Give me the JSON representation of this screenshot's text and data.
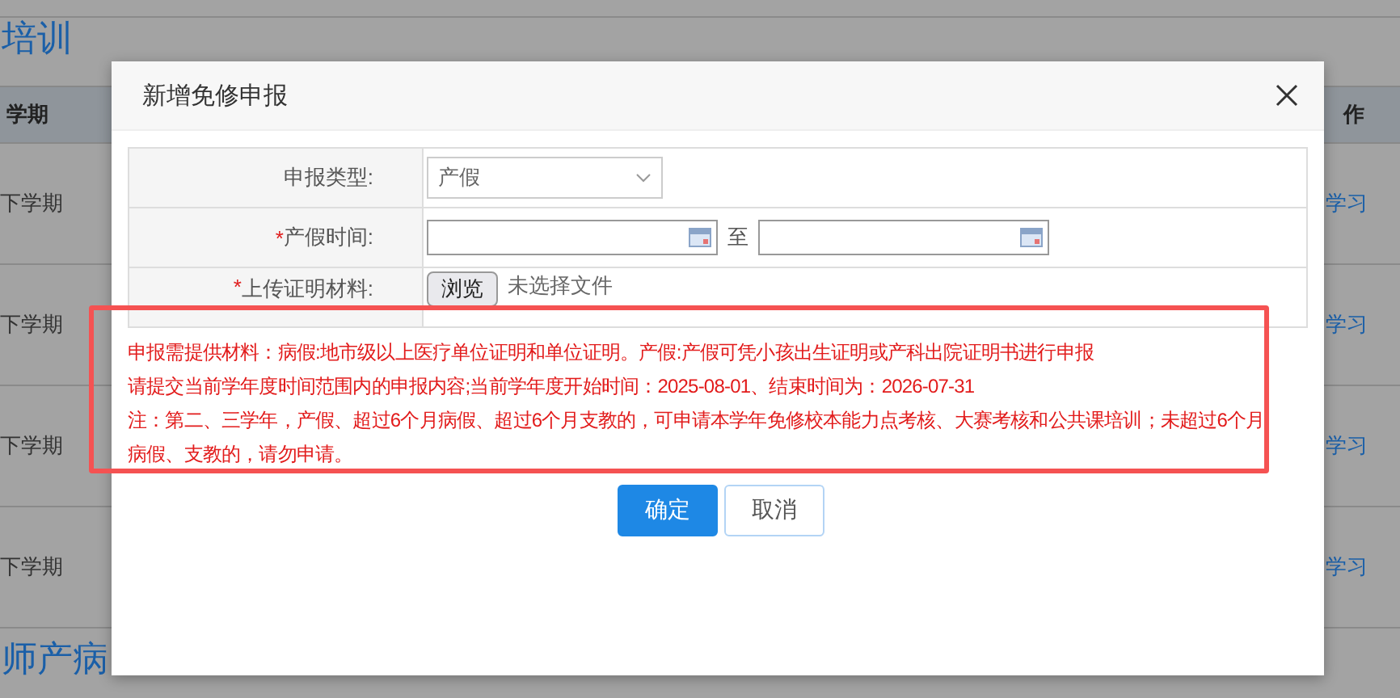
{
  "page": {
    "heading": "培训",
    "table": {
      "columns": [
        "学期",
        "作"
      ],
      "rows": [
        {
          "term": "下学期",
          "action": "学习"
        },
        {
          "term": "下学期",
          "action": "学习"
        },
        {
          "term": "下学期",
          "action": "学习"
        },
        {
          "term": "下学期",
          "action": "学习"
        }
      ]
    },
    "section_heading": "师产病"
  },
  "dialog": {
    "title": "新增免修申报",
    "form": [
      {
        "kind": "select",
        "label": "申报类型:",
        "value": "产假"
      },
      {
        "kind": "date_range",
        "label": "产假时间:",
        "required_mark": "*",
        "separator": "至"
      },
      {
        "kind": "file",
        "label": "上传证明材料:",
        "required_mark": "*",
        "button": "浏览",
        "status": "未选择文件"
      }
    ],
    "notes": [
      "申报需提供材料：病假:地市级以上医疗单位证明和单位证明。产假:产假可凭小孩出生证明或产科出院证明书进行申报",
      "请提交当前学年度时间范围内的申报内容;当前学年度开始时间：2025-08-01、结束时间为：2026-07-31",
      "注：第二、三学年，产假、超过6个月病假、超过6个月支教的，可申请本学年免修校本能力点考核、大赛考核和公共课培训；未超过6个月病假、支教的，请勿申请。"
    ],
    "buttons": [
      {
        "kind": "primary",
        "label": "确定"
      },
      {
        "kind": "default",
        "label": "取消"
      }
    ]
  }
}
